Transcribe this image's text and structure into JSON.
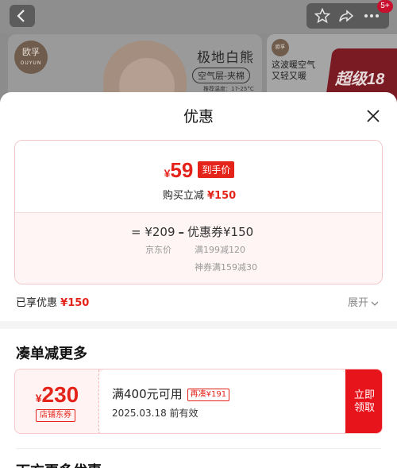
{
  "background": {
    "banner1": {
      "brand": "欧孚",
      "brand_sub": "OUYUN",
      "title": "极地白熊",
      "tag": "空气层-夹棉",
      "small_text": "推荐温度：17-25°C"
    },
    "banner2": {
      "brand": "欧孚",
      "text_line1": "这波暖空气",
      "text_line2": "又轻又暖",
      "big_text": "超级18"
    },
    "cart_badge": "5+"
  },
  "sheet": {
    "title": "优惠",
    "summary_card": {
      "price_currency": "¥",
      "price_value": "59",
      "price_tag": "到手价",
      "reduce_label": "购买立减",
      "reduce_value": "¥150",
      "formula_base": "= ¥209",
      "formula_op": "–",
      "formula_coupon": "优惠券¥150",
      "label_base": "京东价",
      "label_rule1": "满199减120",
      "label_rule2": "神券满159减30"
    },
    "enjoyed_label": "已享优惠",
    "enjoyed_value": "¥150",
    "expand_label": "展开",
    "section_title": "凑单减更多",
    "coupon": {
      "currency": "¥",
      "amount": "230",
      "type": "店铺东券",
      "condition": "满400元可用",
      "add_more": "再凑¥191",
      "expiry": "2025.03.18 前有效",
      "claim_line1": "立即",
      "claim_line2": "领取"
    },
    "next_section_partial": "下方更多优惠"
  },
  "colors": {
    "accent_red": "#e4231a",
    "claim_button": "#e8141c"
  }
}
